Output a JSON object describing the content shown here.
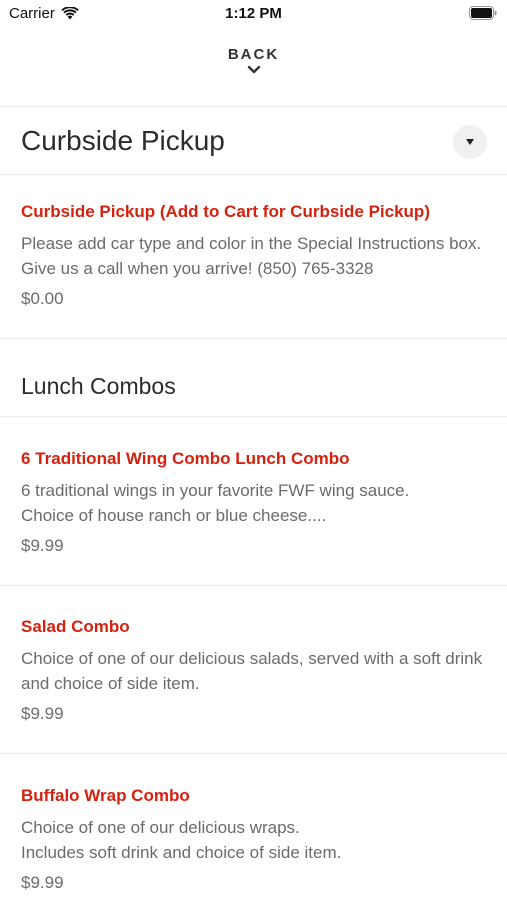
{
  "status_bar": {
    "carrier": "Carrier",
    "time": "1:12 PM",
    "wifi_icon": "wifi-icon",
    "battery_icon": "battery-icon"
  },
  "nav": {
    "back_label": "BACK",
    "chevron_icon": "chevron-down-icon"
  },
  "colors": {
    "accent": "#d4220f",
    "text": "#333333",
    "muted": "#6b6b6b",
    "divider": "#ececec"
  },
  "sections": [
    {
      "title": "Curbside Pickup",
      "dropdown_icon": "caret-down-icon",
      "items": [
        {
          "name": "Curbside Pickup (Add to Cart for Curbside Pickup)",
          "description": "Please add car type and color in the Special Instructions box. Give us a call when you arrive! (850) 765-3328",
          "price": "$0.00"
        }
      ]
    },
    {
      "title": "Lunch Combos",
      "items": [
        {
          "name": "6 Traditional Wing Combo Lunch Combo",
          "description": "6 traditional wings in your favorite FWF wing sauce.\nChoice of house ranch or blue cheese....",
          "price": "$9.99"
        },
        {
          "name": "Salad Combo",
          "description": "Choice of one of our delicious salads, served with a soft drink and choice of side item.",
          "price": "$9.99"
        },
        {
          "name": "Buffalo Wrap Combo",
          "description": "Choice of one of our delicious wraps.\nIncludes soft drink and choice of side item.",
          "price": "$9.99"
        }
      ]
    }
  ]
}
